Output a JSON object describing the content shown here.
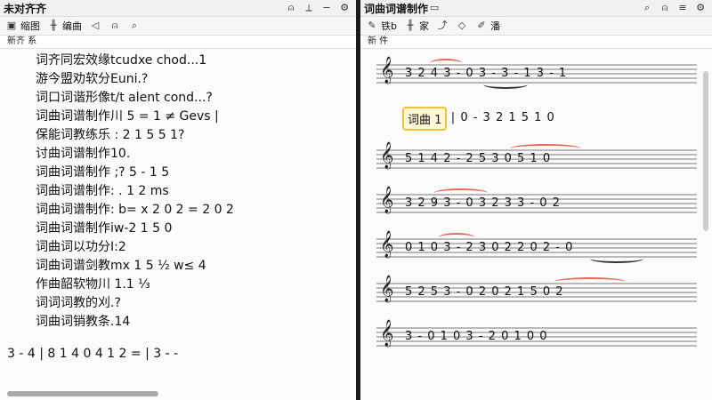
{
  "left": {
    "title": "未对齐齐",
    "toolbar": {
      "item1": "缩图",
      "item2": "编曲"
    },
    "tab": "新齐 系",
    "lines": [
      "词齐同宏效缘tcudxe chod...1",
      "游今盟劝软分Euni.?",
      "词口词谐形像t/t alent cond...?",
      "词曲词谱制作川 5 = 1 ≠ Gevs |",
      "保能词教练乐 : 2  1  5 5  1?",
      "讨曲词谱制作10.",
      "词曲词谱制作 ;?  5 - 1 5",
      "词曲词谱制作: .  1  2 ms",
      "词曲词谱制作:  b= x 2 0 2 = 2 0 2",
      "词曲词谱制作iw-2 1 5 0",
      "词曲词以功分I:2",
      "词曲词谱剑教mx 1 5 ½ w≤ 4",
      "作曲韶软物川 1.1 ⅓",
      "词词词教的刈.?",
      "词曲词销教条.14"
    ],
    "bottom_score": "3 - 4 | 8 1 4  0 4 1 2 = | 3 - -"
  },
  "right": {
    "title": "词曲词谱制作",
    "toolbar": {
      "item1": "铁b",
      "item2": "家",
      "item3": "潘"
    },
    "tab": "新 件",
    "highlight": "词曲 1",
    "staves": [
      "3 2 4 3 - 0  3 -  3 - 1 3 - 1",
      "3 1 |  0 -  3 2 1 5 1  0",
      "5 1 4 2 - 2  5 3 0  5 1 0",
      "3 2 9 3 - 0  3 2 3 3 - 0 2",
      "0 1 0 3 - 2  3 0 2  2 0 2 - 0",
      "5 2 5 3 - 0  2 0 2  1 5 0 2",
      "3 - 0 1  0 3 - 2 0 1  0 0"
    ]
  }
}
